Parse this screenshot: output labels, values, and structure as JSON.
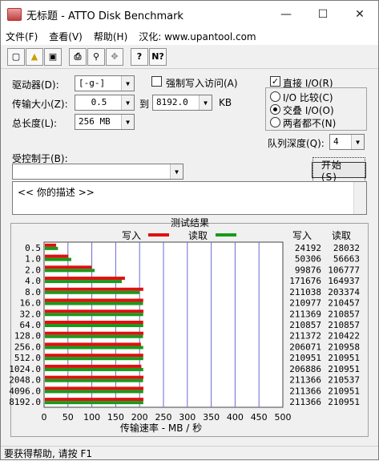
{
  "window": {
    "title": "无标题 - ATTO Disk Benchmark"
  },
  "menu": [
    "文件(F)",
    "查看(V)",
    "帮助(H)",
    "汉化: www.upantool.com"
  ],
  "toolbar_icons": [
    "new-icon",
    "open-icon",
    "save-icon",
    "print-icon",
    "print-preview-icon",
    "move-icon",
    "help-icon",
    "context-help-icon"
  ],
  "form": {
    "drive_label": "驱动器(D):",
    "drive_value": "[-g-]",
    "force_write_label": "强制写入访问(A)",
    "direct_io_label": "直接 I/O(R)",
    "transfer_label": "传输大小(Z):",
    "transfer_from": "0.5",
    "to_label": "到",
    "transfer_to": "8192.0",
    "kb_label": "KB",
    "io_compare_label": "I/O 比较(C)",
    "overlapped_label": "交叠 I/O(O)",
    "neither_label": "两者都不(N)",
    "total_len_label": "总长度(L):",
    "total_len_value": "256 MB",
    "queue_label": "队列深度(Q):",
    "queue_value": "4",
    "controlled_label": "受控制于(B):",
    "controlled_value": "",
    "start_button": "开始(S)",
    "description": "<<  你的描述   >>"
  },
  "results": {
    "title": "测试结果",
    "legend_write": "写入",
    "legend_read": "读取",
    "col_write": "写入",
    "col_read": "读取",
    "x_title": "传输速率 - MB / 秒",
    "colors": {
      "write": "#e01010",
      "read": "#1a9a1a"
    }
  },
  "chart_data": {
    "type": "bar",
    "orientation": "horizontal",
    "categories": [
      "0.5",
      "1.0",
      "2.0",
      "4.0",
      "8.0",
      "16.0",
      "32.0",
      "64.0",
      "128.0",
      "256.0",
      "512.0",
      "1024.0",
      "2048.0",
      "4096.0",
      "8192.0"
    ],
    "series": [
      {
        "name": "写入",
        "values": [
          24192,
          50306,
          99876,
          171676,
          211038,
          210977,
          211369,
          210857,
          211372,
          206071,
          210951,
          206886,
          211366,
          211366,
          211366
        ]
      },
      {
        "name": "读取",
        "values": [
          28032,
          56663,
          106777,
          164937,
          203374,
          210457,
          210857,
          210857,
          210422,
          210958,
          210951,
          210951,
          210537,
          210951,
          210951
        ]
      }
    ],
    "xlim": [
      0,
      500
    ],
    "xticks": [
      "0",
      "50",
      "100",
      "150",
      "200",
      "250",
      "300",
      "350",
      "400",
      "450",
      "500"
    ],
    "xlabel": "传输速率 - MB / 秒"
  },
  "status": "要获得帮助, 请按 F1"
}
